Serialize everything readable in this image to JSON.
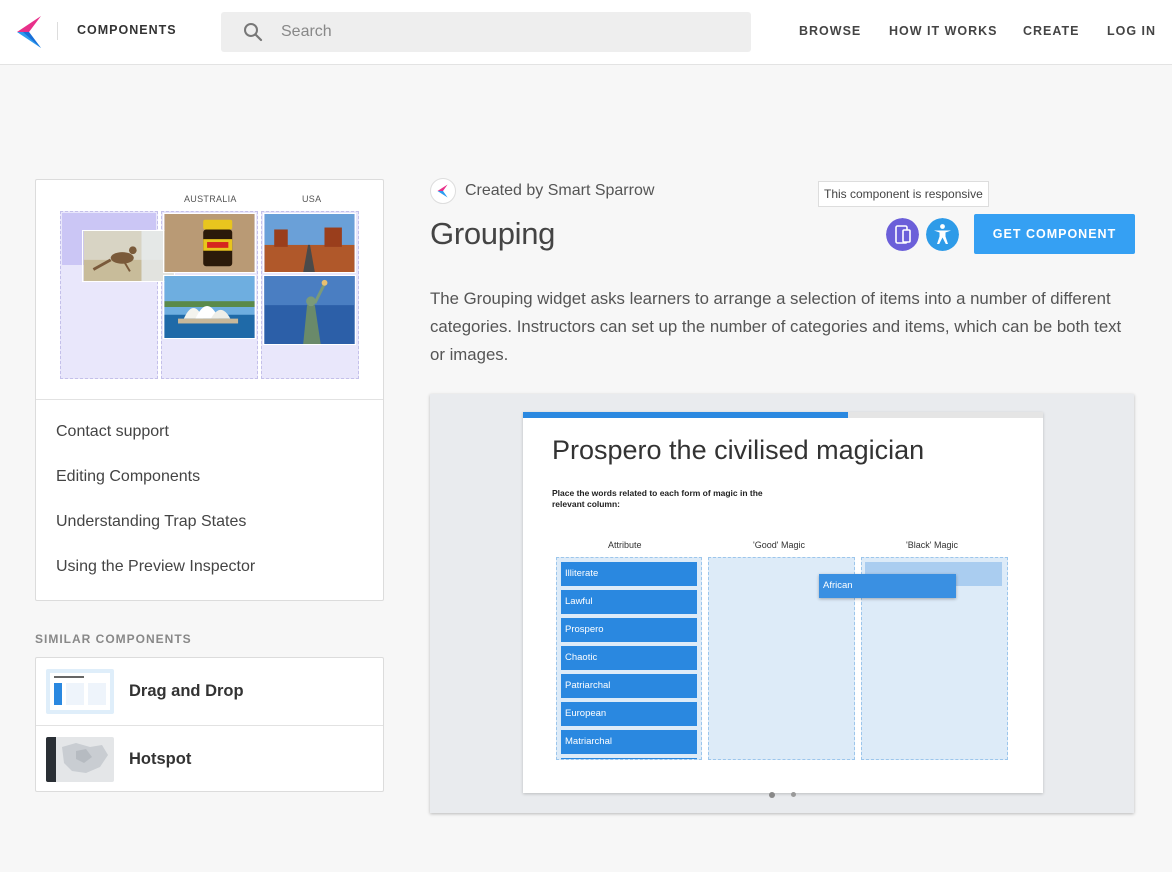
{
  "header": {
    "brand": "COMPONENTS",
    "search_placeholder": "Search",
    "nav": [
      "BROWSE",
      "HOW IT WORKS",
      "CREATE",
      "LOG IN"
    ]
  },
  "thumbnail": {
    "column_labels": [
      "AUSTRALIA",
      "USA"
    ]
  },
  "support_links": [
    "Contact support",
    "Editing Components",
    "Understanding Trap States",
    "Using the Preview Inspector"
  ],
  "similar": {
    "title": "SIMILAR COMPONENTS",
    "items": [
      "Drag and Drop",
      "Hotspot"
    ]
  },
  "component": {
    "creator": "Created by Smart Sparrow",
    "title": "Grouping",
    "tooltip": "This component is responsive",
    "get_button": "GET COMPONENT",
    "description": "The Grouping widget asks learners to arrange a selection of items into a number of different categories. Instructors can set up the number of categories and items, which can be both text or images."
  },
  "preview": {
    "progress": 0.625,
    "title": "Prospero the civilised magician",
    "instruction": "Place the words related to each form of magic in the relevant column:",
    "columns": [
      "Attribute",
      "'Good' Magic",
      "'Black' Magic"
    ],
    "items": [
      "Illiterate",
      "Lawful",
      "Prospero",
      "Chaotic",
      "Patriarchal",
      "European",
      "Matriarchal"
    ],
    "dragging_item": "African"
  },
  "colors": {
    "accent": "#35a0f3",
    "progress": "#2a88e0",
    "responsive_badge": "#6b5fd9",
    "accessible_badge": "#2e9be8"
  }
}
